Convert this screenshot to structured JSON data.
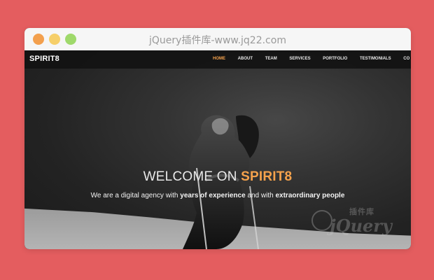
{
  "window": {
    "title": "jQuery插件库-www.jq22.com"
  },
  "site": {
    "brand": "SPIRIT8",
    "nav": [
      {
        "label": "HOME",
        "active": true
      },
      {
        "label": "ABOUT"
      },
      {
        "label": "TEAM"
      },
      {
        "label": "SERVICES"
      },
      {
        "label": "PORTFOLIO"
      },
      {
        "label": "TESTIMONIALS"
      },
      {
        "label": "CO"
      }
    ],
    "hero": {
      "title_prefix": "WELCOME ON",
      "title_accent": "SPIRIT8",
      "subtitle_start": "We are a digital agency with",
      "subtitle_bold1": "years of experience",
      "subtitle_middle": "and with",
      "subtitle_bold2": "extraordinary people"
    },
    "watermark": {
      "top": "插件库",
      "main": "jQuery"
    }
  },
  "colors": {
    "page_bg": "#e45d5f",
    "accent": "#f5a24c"
  },
  "icons": {
    "close": "orange-traffic-dot",
    "minimize": "yellow-traffic-dot",
    "maximize": "green-traffic-dot"
  }
}
